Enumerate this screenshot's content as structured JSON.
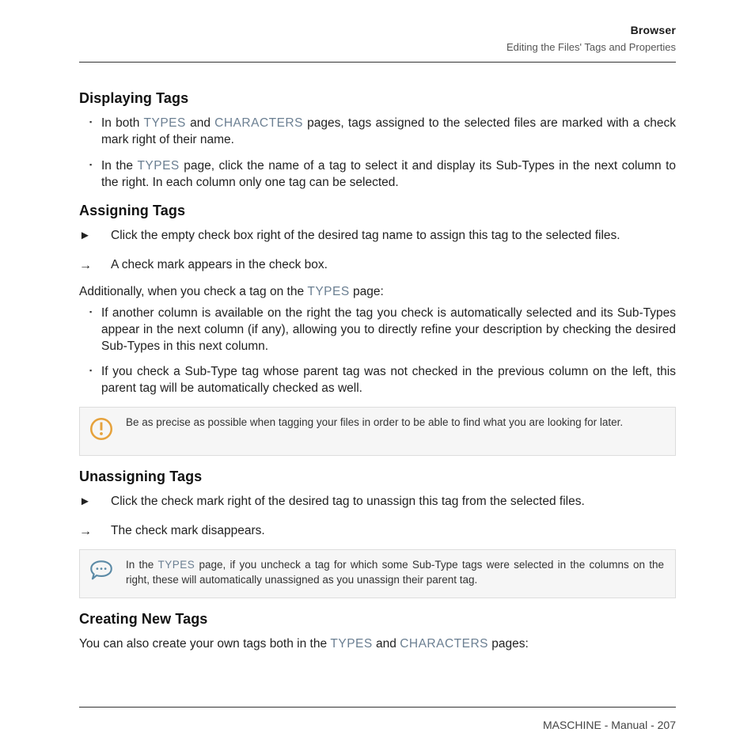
{
  "header": {
    "title": "Browser",
    "subtitle": "Editing the Files' Tags and Properties"
  },
  "links": {
    "types": "TYPES",
    "characters": "CHARACTERS"
  },
  "sections": {
    "displaying": {
      "heading": "Displaying Tags",
      "b1a": "In both ",
      "b1b": " and ",
      "b1c": " pages, tags assigned to the selected files are marked with a check mark right of their name.",
      "b2a": "In the ",
      "b2b": " page, click the name of a tag to select it and display its Sub-Types in the next column to the right. In each column only one tag can be selected."
    },
    "assigning": {
      "heading": "Assigning Tags",
      "step": "Click the empty check box right of the desired tag name to assign this tag to the selected files.",
      "result": "A check mark appears in the check box.",
      "add_a": "Additionally, when you check a tag on the ",
      "add_b": " page:",
      "b1": "If another column is available on the right the tag you check is automatically selected and its Sub-Types appear in the next column (if any), allowing you to directly refine your description by checking the desired Sub-Types in this next column.",
      "b2": "If you check a Sub-Type tag whose parent tag was not checked in the previous column on the left, this parent tag will be automatically checked as well.",
      "note": "Be as precise as possible when tagging your files in order to be able to find what you are looking for later."
    },
    "unassigning": {
      "heading": "Unassigning Tags",
      "step": "Click the check mark right of the desired tag to unassign this tag from the selected files.",
      "result": "The check mark disappears.",
      "note_a": "In the ",
      "note_b": " page, if you uncheck a tag for which some Sub-Type tags were selected in the columns on the right, these will automatically unassigned as you unassign their parent tag."
    },
    "creating": {
      "heading": "Creating New Tags",
      "p_a": "You can also create your own tags both in the ",
      "p_b": " and ",
      "p_c": " pages:"
    }
  },
  "footer": {
    "text": "MASCHINE - Manual - 207"
  }
}
